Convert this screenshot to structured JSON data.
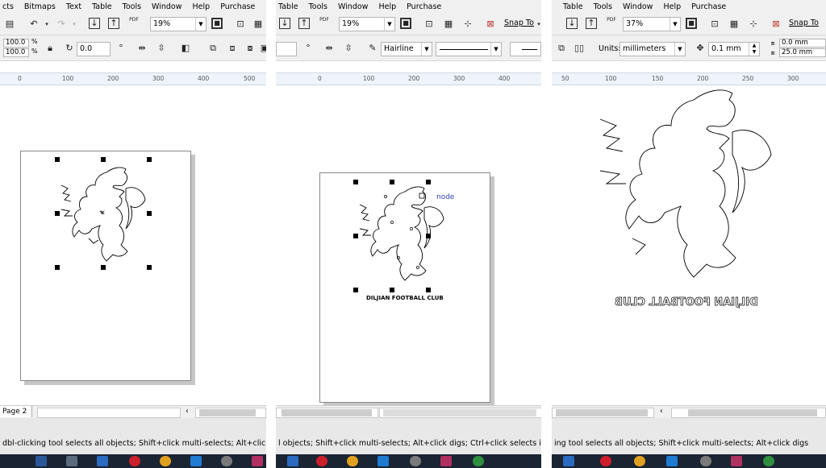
{
  "menus": {
    "p1": [
      "cts",
      "Bitmaps",
      "Text",
      "Table",
      "Tools",
      "Window",
      "Help",
      "Purchase"
    ],
    "p2": [
      "Table",
      "Tools",
      "Window",
      "Help",
      "Purchase"
    ],
    "p3": [
      "Table",
      "Tools",
      "Window",
      "Help",
      "Purchase"
    ]
  },
  "toolbar": {
    "zoom_p1": "19%",
    "zoom_p2": "19%",
    "zoom_p3": "37%",
    "snap_label": "Snap To",
    "pdf_label": "PDF"
  },
  "property_bar": {
    "scale_w": "100.0",
    "scale_h": "100.0",
    "pct": "%",
    "rotation_p1": "0.0",
    "outline_width": "Hairline",
    "units_label": "Units:",
    "units_value": "millimeters",
    "nudge": "0.1 mm",
    "dup_x": "0.0 mm",
    "dup_y": "25.0 mm"
  },
  "rulers": {
    "p1": [
      "0",
      "100",
      "200",
      "300",
      "400",
      "500"
    ],
    "p2": [
      "0",
      "100",
      "200",
      "300",
      "400"
    ],
    "p3": [
      "50",
      "100",
      "150",
      "200",
      "250",
      "300"
    ]
  },
  "canvas": {
    "node_label": "node",
    "club_name": "DILJIAN FOOTBALL CLUB"
  },
  "status": {
    "page_tab": "Page 2",
    "hint_p1": "dbl-clicking tool selects all objects; Shift+click multi-selects; Alt+click digs; Ctrl+click selects in a group",
    "hint_p2": "l objects; Shift+click multi-selects; Alt+click digs; Ctrl+click selects in a group",
    "hint_p3": "ing tool selects all objects; Shift+click multi-selects; Alt+click digs"
  },
  "colors": {
    "toolbar_bg": "#f0f0f0",
    "ruler_bg": "#eef4fa",
    "taskbar_bg": "#1b2433",
    "node_label": "#3344aa"
  },
  "icons": [
    "undo-icon",
    "redo-icon",
    "import-icon",
    "export-icon",
    "publish-pdf-icon",
    "full-screen-icon",
    "welcome-screen-icon",
    "snap-icon",
    "lock-ratio-icon",
    "rotate-icon",
    "mirror-icon",
    "outline-pen-icon",
    "nudge-icon"
  ]
}
